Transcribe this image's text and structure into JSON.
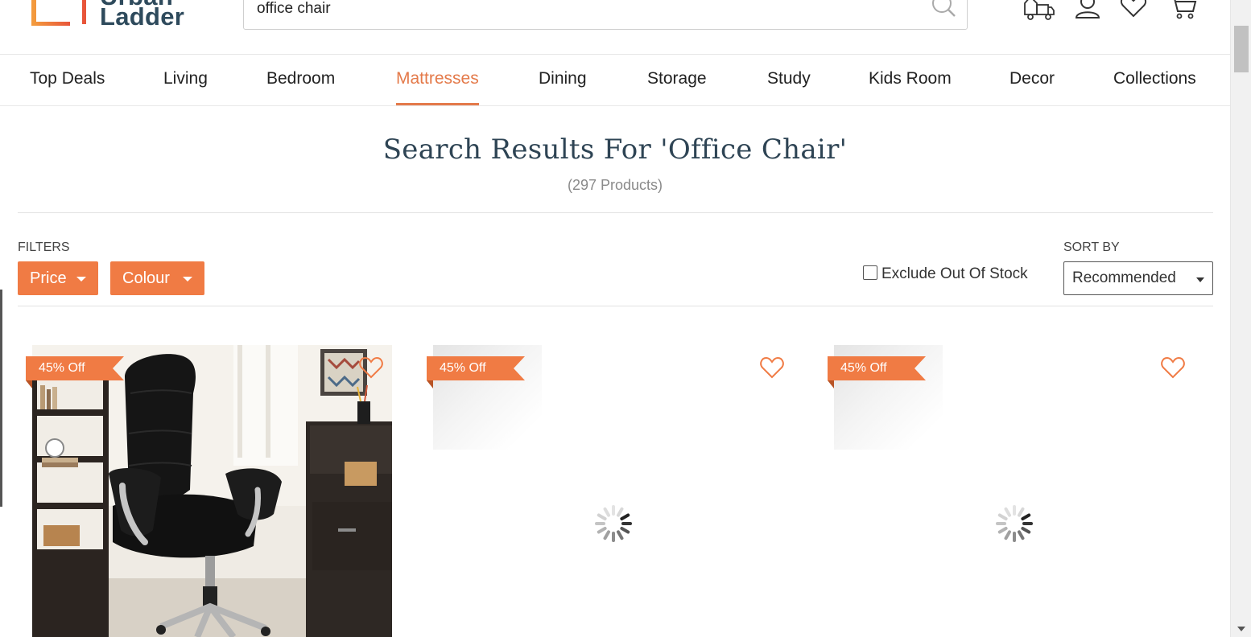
{
  "header": {
    "logo_line1": "Urban",
    "logo_line2": "Ladder",
    "search_value": "office chair",
    "icons": [
      "delivery-truck-icon",
      "user-icon",
      "wishlist-heart-icon",
      "cart-icon"
    ]
  },
  "nav": {
    "items": [
      {
        "label": "Top Deals"
      },
      {
        "label": "Living"
      },
      {
        "label": "Bedroom"
      },
      {
        "label": "Mattresses",
        "active": true
      },
      {
        "label": "Dining"
      },
      {
        "label": "Storage"
      },
      {
        "label": "Study"
      },
      {
        "label": "Kids Room"
      },
      {
        "label": "Decor"
      },
      {
        "label": "Collections"
      }
    ]
  },
  "results": {
    "title": "Search Results For 'Office Chair'",
    "count": "(297 Products)"
  },
  "filters": {
    "label": "FILTERS",
    "price_label": "Price",
    "colour_label": "Colour",
    "exclude_oos_label": "Exclude Out Of Stock",
    "exclude_oos_checked": false,
    "sort_label": "SORT BY",
    "sort_value": "Recommended"
  },
  "products": [
    {
      "badge": "45% Off",
      "image": "black-leather-office-chair",
      "loaded": true
    },
    {
      "badge": "45% Off",
      "image": "loading-spinner",
      "loaded": false
    },
    {
      "badge": "45% Off",
      "image": "loading-spinner",
      "loaded": false
    }
  ],
  "colors": {
    "accent": "#f07b44",
    "nav_active": "#e47a4a",
    "logo_text": "#2e4a5c",
    "title_text": "#2e4454"
  }
}
